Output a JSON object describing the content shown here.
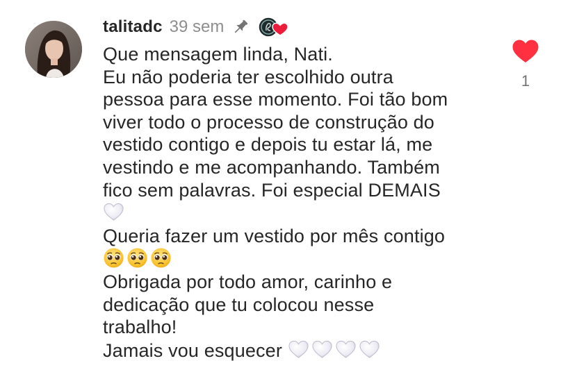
{
  "comment": {
    "username": "talitadc",
    "time": "39 sem",
    "lines": [
      "Que mensagem linda, Nati.",
      "Eu não poderia ter escolhido outra",
      "pessoa para esse momento. Foi tão bom",
      "viver todo o processo de construção do",
      "vestido contigo e depois tu estar lá, me",
      "vestindo e me acompanhando. Também",
      "fico sem palavras. Foi especial DEMAIS",
      "Queria fazer um vestido por mês contigo",
      "Obrigada por todo amor, carinho e",
      "dedicação que tu colocou nesse",
      "trabalho!",
      "Jamais vou esquecer"
    ],
    "like_count": "1",
    "icons": {
      "pin": "pin-icon",
      "liked_by_creator": "creator-heart-badge-icon",
      "like": "heart-icon",
      "white_heart": "white-heart-emoji",
      "pleading_face": "pleading-face-emoji"
    },
    "colors": {
      "username": "#262626",
      "meta": "#8e8e8e",
      "like_heart": "#ff3040"
    }
  }
}
